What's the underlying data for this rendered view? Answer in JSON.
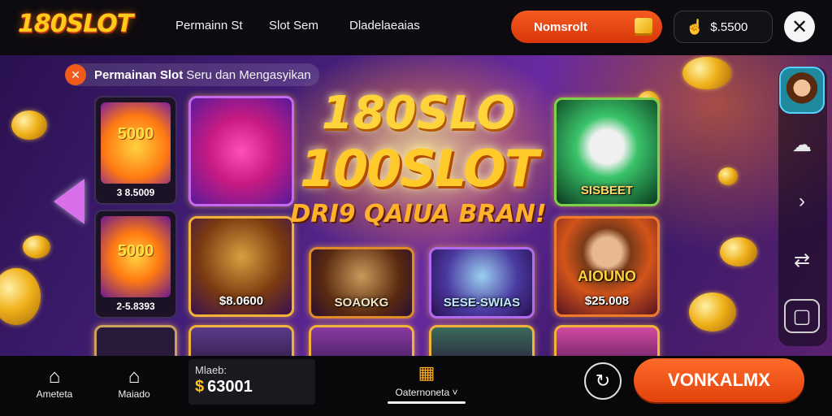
{
  "header": {
    "logo": "180SLOT",
    "nav": [
      "Permainn St",
      "Slot Sem",
      "Dladelaeaias"
    ],
    "promo_label": "Nomsrolt",
    "balance": "$.5500",
    "close_icon": "close-icon"
  },
  "main": {
    "tagline_strong": "Permainan Slot",
    "tagline_light": "Seru dan Mengasyikan",
    "hero": {
      "line1": "180SLO",
      "line2": "100SLOT",
      "line3": "DRI9 QAIUA BRAN!"
    },
    "left_column": [
      {
        "number": "5000",
        "price": "3 8.5009"
      },
      {
        "number": "5000",
        "price": "2-5.8393"
      }
    ],
    "tiles": [
      {
        "caption": ""
      },
      {
        "caption": "SISBEET"
      },
      {
        "caption": "$8.0600"
      },
      {
        "caption": "SOAOKG"
      },
      {
        "caption": "SESE-SWIAS"
      },
      {
        "caption": "AIOUNO $25.008"
      }
    ],
    "tile_captions": {
      "heart": "",
      "sisbeet": "SISBEET",
      "gold": "$8.0600",
      "ticket": "SOAOKG",
      "sese": "SESE-SWIAS",
      "character_title": "AIOUNO",
      "character_price": "$25.008"
    }
  },
  "footer": {
    "home_label": "Ameteta",
    "store_label": "Maiado",
    "wallet_caption": "Mlaeb:",
    "wallet_amount": "63001",
    "wallet_currency": "$",
    "categories_label": "Oaternoneta",
    "cta_label": "VONKALMX"
  },
  "colors": {
    "accent": "#f05a1a",
    "gold": "#ffcc1a",
    "purple": "#44207a"
  }
}
